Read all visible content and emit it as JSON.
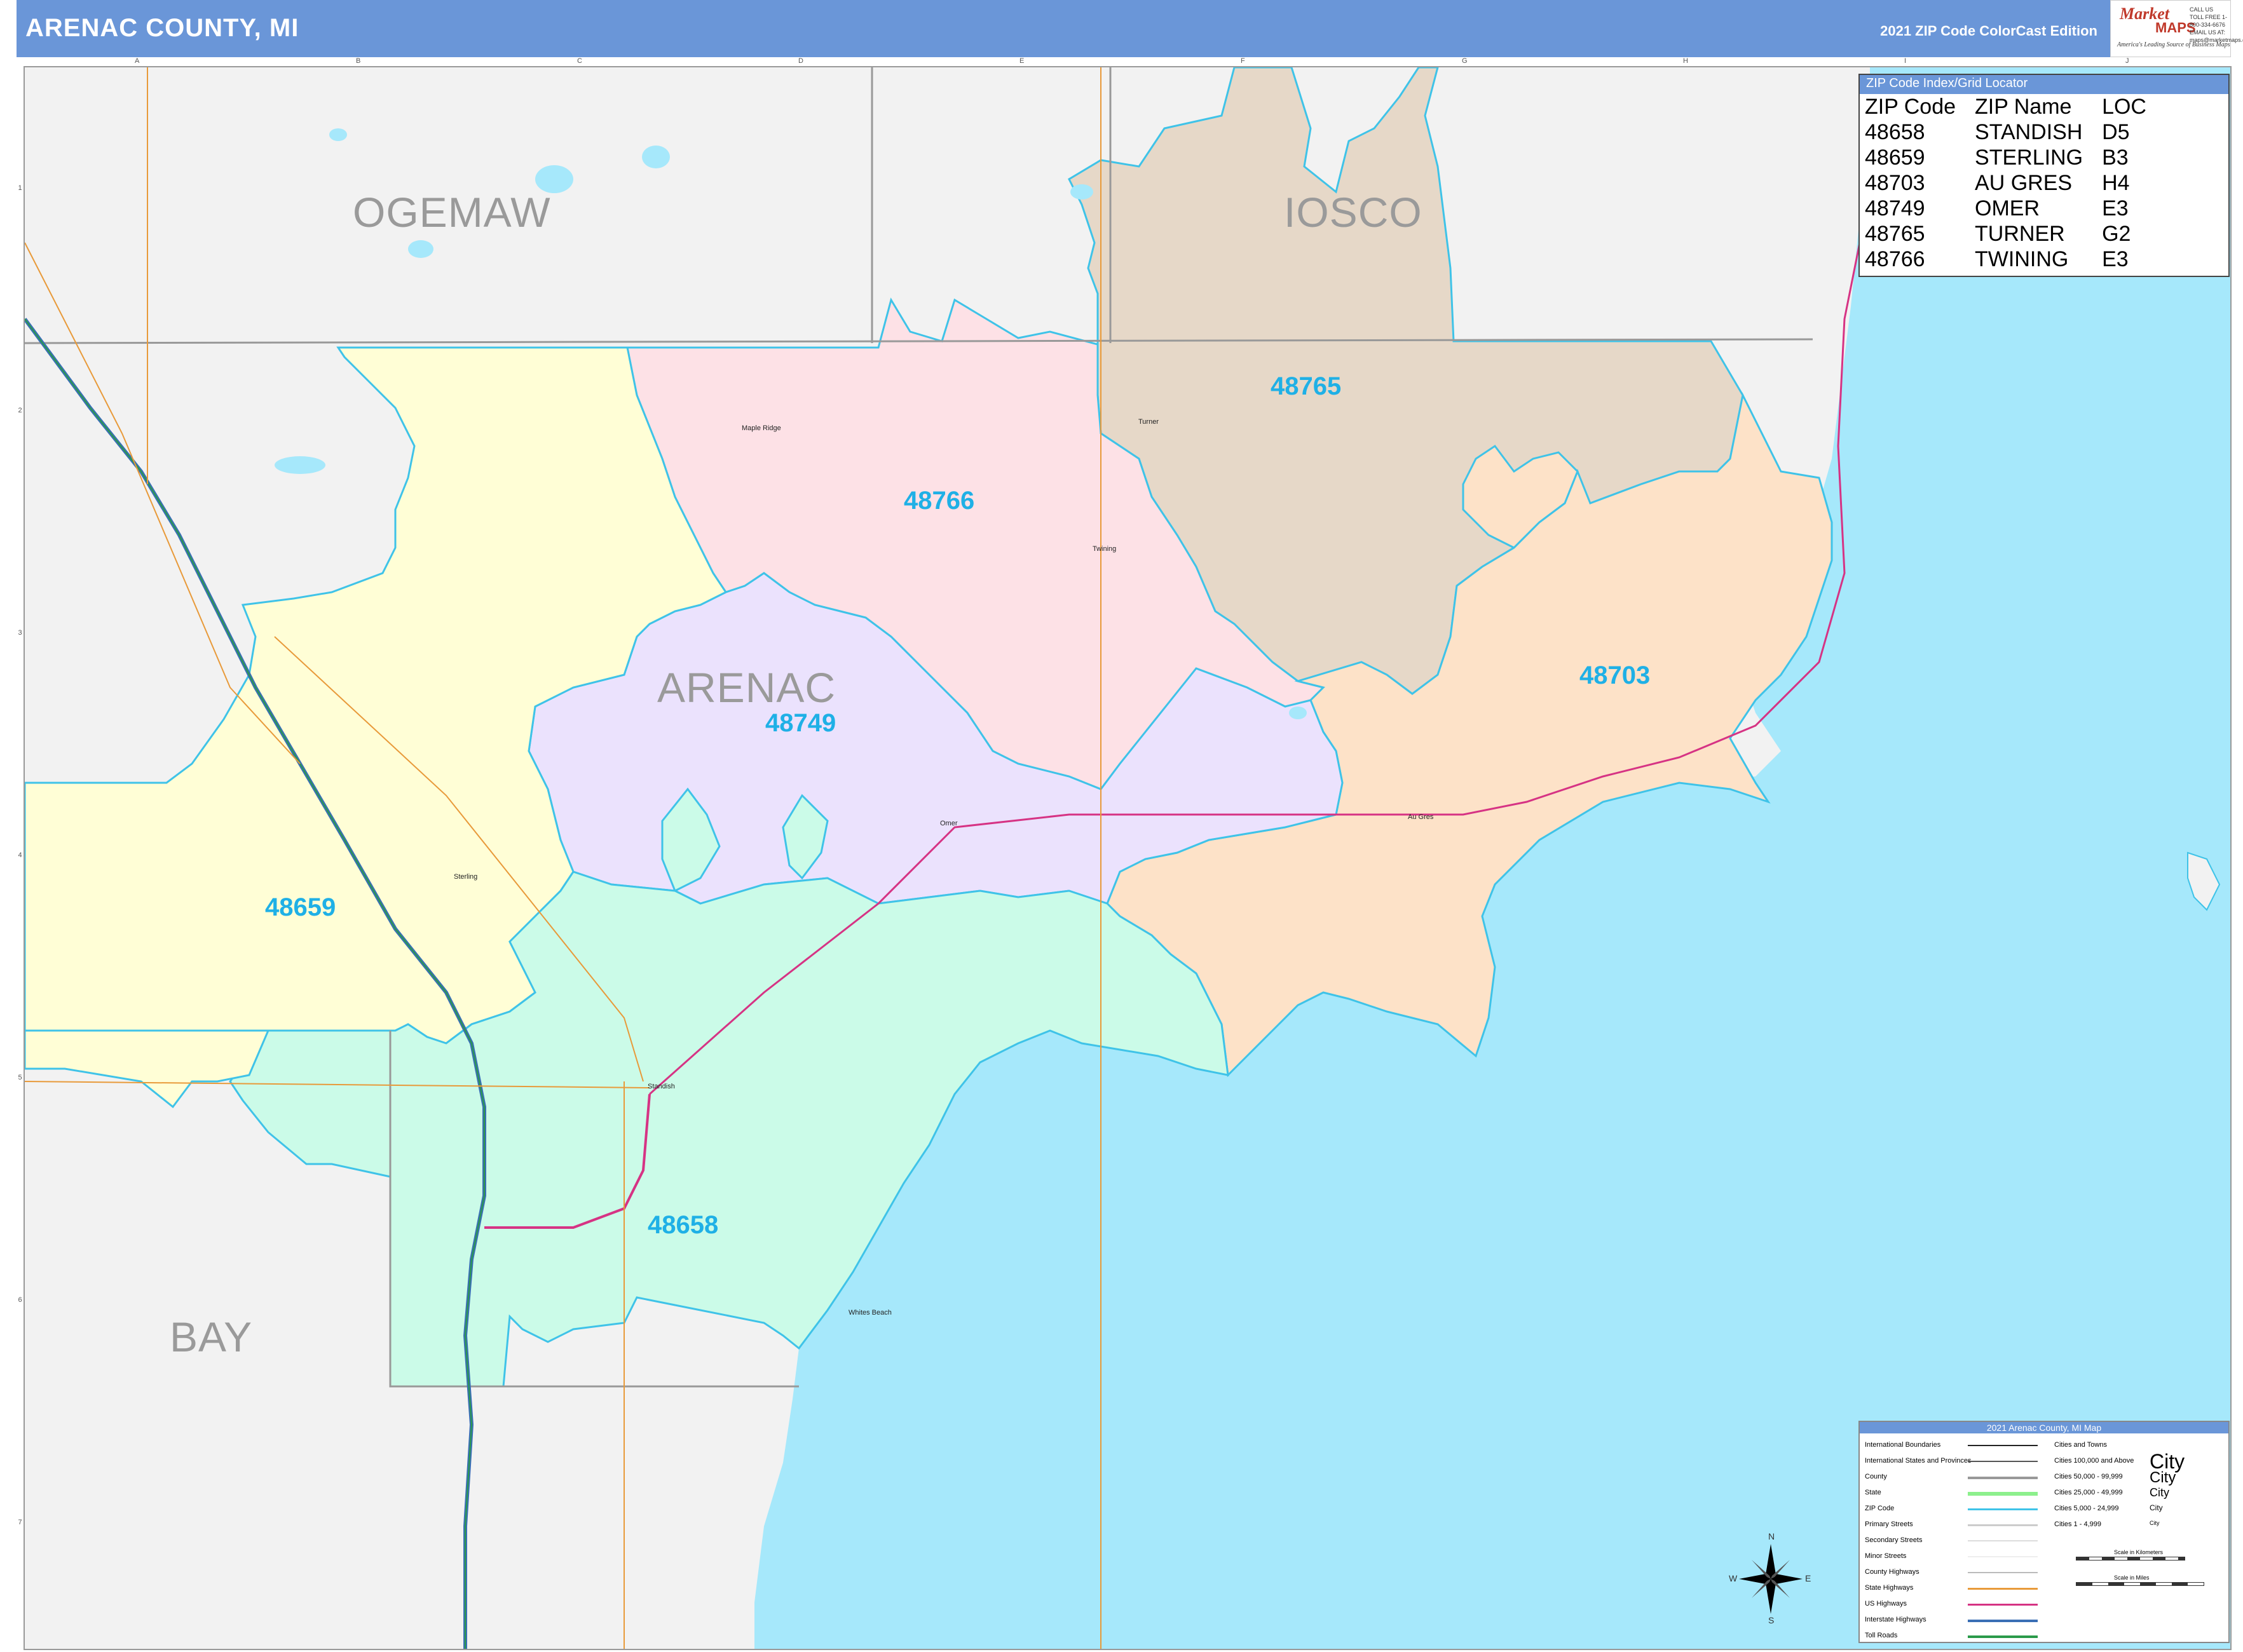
{
  "header": {
    "title": "ARENAC COUNTY, MI",
    "edition": "2021 ZIP Code ColorCast Edition",
    "logo_top": "Market",
    "logo_bottom": "MAPS",
    "logo_tagline": "America's Leading Source of Business Maps",
    "logo_slogan": "On Target, On Time.",
    "logo_contact": "CALL US TOLL FREE 1-800-334-6676 EMAIL US AT: maps@marketmaps.com"
  },
  "grid": {
    "columns": [
      "A",
      "B",
      "C",
      "D",
      "E",
      "F",
      "G",
      "H",
      "I",
      "J"
    ],
    "rows": [
      "1",
      "2",
      "3",
      "4",
      "5",
      "6",
      "7"
    ]
  },
  "counties": {
    "ogemaw": "OGEMAW",
    "iosco": "IOSCO",
    "arenac": "ARENAC",
    "bay": "BAY"
  },
  "zip_labels": {
    "z48765": "48765",
    "z48766": "48766",
    "z48749": "48749",
    "z48703": "48703",
    "z48659": "48659",
    "z48658": "48658"
  },
  "places": {
    "maple_ridge": "Maple Ridge",
    "turner": "Turner",
    "twining": "Twining",
    "omer": "Omer",
    "au_gres": "Au Gres",
    "sterling": "Sterling",
    "standish": "Standish",
    "whites_beach": "Whites Beach"
  },
  "zip_index": {
    "title": "ZIP Code Index/Grid Locator",
    "headers": [
      "ZIP Code",
      "ZIP Name",
      "LOC"
    ],
    "rows": [
      [
        "48658",
        "STANDISH",
        "D5"
      ],
      [
        "48659",
        "STERLING",
        "B3"
      ],
      [
        "48703",
        "AU GRES",
        "H4"
      ],
      [
        "48749",
        "OMER",
        "E3"
      ],
      [
        "48765",
        "TURNER",
        "G2"
      ],
      [
        "48766",
        "TWINING",
        "E3"
      ]
    ]
  },
  "legend": {
    "title": "2021 Arenac County, MI Map",
    "items": [
      "International Boundaries",
      "International States and Provinces",
      "County",
      "State",
      "ZIP Code",
      "Primary Streets",
      "Secondary Streets",
      "Minor Streets",
      "County Highways",
      "State Highways",
      "US Highways",
      "Interstate Highways",
      "Toll Roads"
    ],
    "cities_title": "Cities and Towns",
    "city_classes": [
      "Cities 100,000 and Above",
      "Cities 50,000 - 99,999",
      "Cities 25,000 - 49,999",
      "Cities 5,000 - 24,999",
      "Cities 1 - 4,999"
    ],
    "city_word": "City",
    "scale_km": "Scale in Kilometers",
    "scale_mi": "Scale in Miles"
  },
  "compass": {
    "n": "N",
    "s": "S",
    "e": "E",
    "w": "W"
  },
  "colors": {
    "header": "#6a96d8",
    "water": "#a6e8fb",
    "outside": "#f2f2f2",
    "z48659": "#fffed6",
    "z48766": "#fde1e6",
    "z48765": "#e6d8c8",
    "z48749": "#ebe2fd",
    "z48703": "#fde2c8",
    "z48658": "#cbfbe8",
    "zip_border": "#3fc3e8",
    "zip_label": "#1fb0e6"
  }
}
